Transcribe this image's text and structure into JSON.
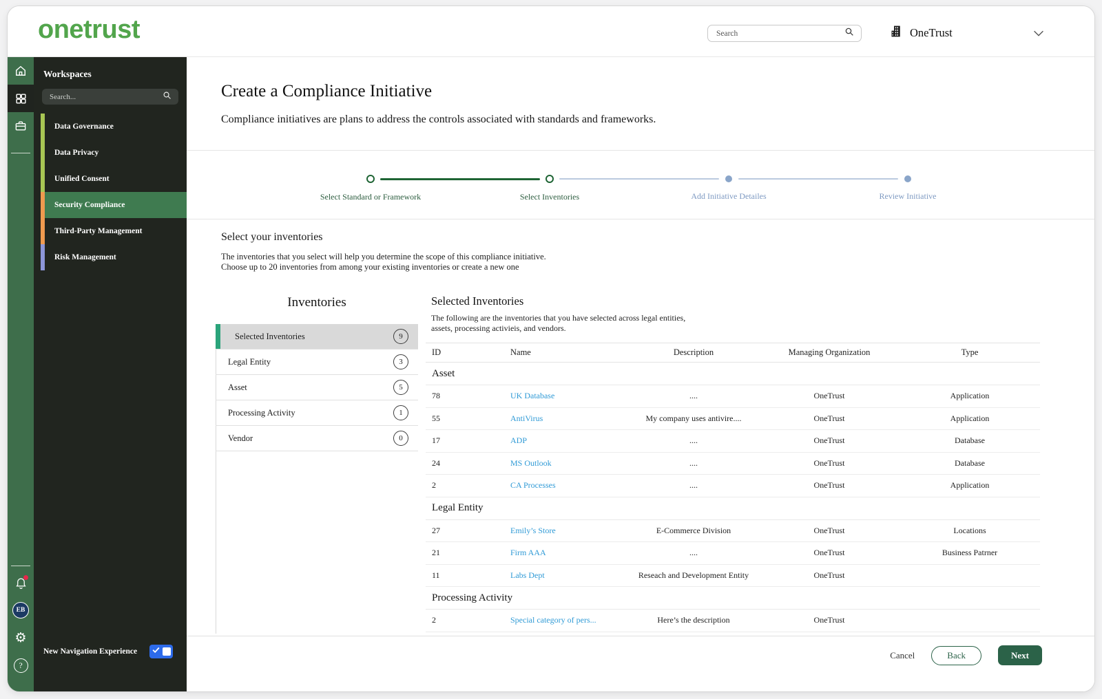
{
  "header": {
    "logo": "onetrust",
    "search_placeholder": "Search",
    "org_name": "OneTrust"
  },
  "sidebar_rail": {
    "top_icons": [
      "home-icon",
      "apps-grid-icon",
      "briefcase-icon"
    ],
    "bottom_icons": [
      "bell-icon",
      "avatar",
      "gear-icon",
      "help-icon"
    ],
    "avatar_initials": "EB",
    "bell_has_notification": true
  },
  "workspaces": {
    "title": "Workspaces",
    "search_placeholder": "Search...",
    "items": [
      {
        "label": "Data Governance",
        "bar_color": "#a8c653",
        "selected": false
      },
      {
        "label": "Data Privacy",
        "bar_color": "#a8c653",
        "selected": false
      },
      {
        "label": "Unified Consent",
        "bar_color": "#a8c653",
        "selected": false
      },
      {
        "label": "Security Compliance",
        "bar_color": "#ef9a4f",
        "selected": true
      },
      {
        "label": "Third-Party Management",
        "bar_color": "#ef9a4f",
        "selected": false
      },
      {
        "label": "Risk Management",
        "bar_color": "#8d96d8",
        "selected": false
      }
    ],
    "new_nav_label": "New Navigation Experience",
    "new_nav_enabled": true
  },
  "page": {
    "title": "Create a Compliance Initiative",
    "subtitle": "Compliance initiatives are plans to address the controls associated with standards and frameworks.",
    "steps": [
      {
        "label": "Select Standard or Framework",
        "state": "active"
      },
      {
        "label": "Select Inventories",
        "state": "active"
      },
      {
        "label": "Add Initiative Detailes",
        "state": "upcoming"
      },
      {
        "label": "Review Initiative",
        "state": "upcoming"
      }
    ],
    "section_heading": "Select your inventories",
    "section_desc_line1": "The inventories that you select will help you determine the scope of this compliance initiative.",
    "section_desc_line2": "Choose up to 20 inventories from among your existing inventories or create a new one"
  },
  "inventories_panel": {
    "title": "Inventories",
    "items": [
      {
        "label": "Selected Inventories",
        "count": "9",
        "selected": true
      },
      {
        "label": "Legal Entity",
        "count": "3",
        "selected": false
      },
      {
        "label": "Asset",
        "count": "5",
        "selected": false
      },
      {
        "label": "Processing Activity",
        "count": "1",
        "selected": false
      },
      {
        "label": "Vendor",
        "count": "0",
        "selected": false
      }
    ]
  },
  "selected_inventories": {
    "title": "Selected Inventories",
    "desc_line1": "The following are the inventories that you have selected across legal entities,",
    "desc_line2": "assets, processing activieis, and vendors.",
    "columns": [
      "ID",
      "Name",
      "Description",
      "Managing Organization",
      "Type"
    ],
    "groups": [
      {
        "name": "Asset",
        "rows": [
          {
            "id": "78",
            "name": "UK Database",
            "description": "....",
            "org": "OneTrust",
            "type": "Application"
          },
          {
            "id": "55",
            "name": "AntiVirus",
            "description": "My company uses antivire....",
            "org": "OneTrust",
            "type": "Application"
          },
          {
            "id": "17",
            "name": "ADP",
            "description": "....",
            "org": "OneTrust",
            "type": "Database"
          },
          {
            "id": "24",
            "name": "MS Outlook",
            "description": "....",
            "org": "OneTrust",
            "type": "Database"
          },
          {
            "id": "2",
            "name": "CA Processes",
            "description": "....",
            "org": "OneTrust",
            "type": "Application"
          }
        ]
      },
      {
        "name": "Legal Entity",
        "rows": [
          {
            "id": "27",
            "name": "Emily’s Store",
            "description": "E-Commerce Division",
            "org": "OneTrust",
            "type": "Locations"
          },
          {
            "id": "21",
            "name": "Firm AAA",
            "description": "....",
            "org": "OneTrust",
            "type": "Business Patrner"
          },
          {
            "id": "11",
            "name": "Labs Dept",
            "description": "Reseach and Development Entity",
            "org": "OneTrust",
            "type": ""
          }
        ]
      },
      {
        "name": "Processing Activity",
        "rows": [
          {
            "id": "2",
            "name": "Special category of pers...",
            "description": "Here’s the description",
            "org": "OneTrust",
            "type": ""
          }
        ]
      }
    ]
  },
  "footer": {
    "cancel_label": "Cancel",
    "back_label": "Back",
    "next_label": "Next"
  },
  "colors": {
    "brand_green": "#52a54c",
    "rail_green": "#3e6e4b",
    "selected_workspace_green": "#3f7b50",
    "accent_dark_green": "#2b6248",
    "stepper_active_green": "#1e6434",
    "stepper_inactive_blue": "#8aa5c9",
    "link_blue": "#2f9ad6",
    "toggle_blue": "#2d6bea",
    "selected_inventory_bar_teal": "#2ba47b",
    "notification_red": "#e8274b"
  }
}
